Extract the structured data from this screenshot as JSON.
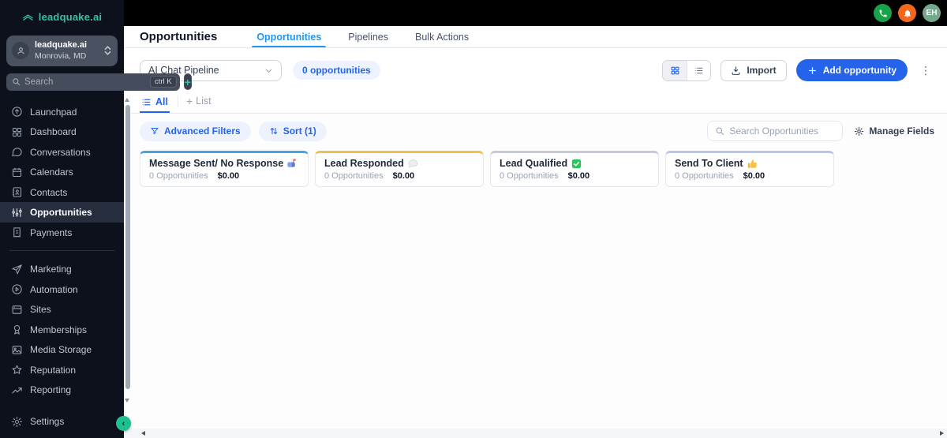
{
  "colors": {
    "sidebar_bg": "#0c111c",
    "brand_teal": "#35c3a4",
    "brand_green": "#1fc08f",
    "accent_blue": "#2563eb",
    "tab_blue": "#2196f3",
    "phone_green": "#16a34a",
    "bell_orange": "#f2691e",
    "avatar_green": "#73a98c"
  },
  "brand": {
    "logo_text": "leadquake.ai"
  },
  "topbar": {
    "avatar_initials": "EH"
  },
  "sidebar": {
    "account": {
      "name": "leadquake.ai",
      "location": "Monrovia, MD"
    },
    "search": {
      "placeholder": "Search",
      "shortcut": "ctrl K"
    },
    "nav_top": [
      {
        "label": "Launchpad"
      },
      {
        "label": "Dashboard"
      },
      {
        "label": "Conversations"
      },
      {
        "label": "Calendars"
      },
      {
        "label": "Contacts"
      },
      {
        "label": "Opportunities",
        "active": true
      },
      {
        "label": "Payments"
      }
    ],
    "nav_bottom": [
      {
        "label": "Marketing"
      },
      {
        "label": "Automation"
      },
      {
        "label": "Sites"
      },
      {
        "label": "Memberships"
      },
      {
        "label": "Media Storage"
      },
      {
        "label": "Reputation"
      },
      {
        "label": "Reporting"
      }
    ],
    "settings_label": "Settings"
  },
  "header": {
    "title": "Opportunities",
    "tabs": [
      {
        "label": "Opportunities",
        "active": true
      },
      {
        "label": "Pipelines"
      },
      {
        "label": "Bulk Actions"
      }
    ]
  },
  "toolbar": {
    "pipeline_select_value": "AI Chat Pipeline",
    "count_badge": "0 opportunities",
    "import_label": "Import",
    "add_label": "Add opportunity"
  },
  "view_tabs": {
    "all_label": "All",
    "add_list_label": "List"
  },
  "filters": {
    "advanced_label": "Advanced Filters",
    "sort_label": "Sort (1)",
    "search_placeholder": "Search Opportunities",
    "manage_fields_label": "Manage Fields"
  },
  "board": {
    "columns": [
      {
        "title": "Message Sent/ No Response",
        "icon": "mailbox-icon",
        "count": "0 Opportunities",
        "value": "$0.00",
        "accent": "#45a5e6"
      },
      {
        "title": "Lead Responded",
        "icon": "speech-bubble-icon",
        "count": "0 Opportunities",
        "value": "$0.00",
        "accent": "#f0c14b"
      },
      {
        "title": "Lead Qualified",
        "icon": "green-check-icon",
        "count": "0 Opportunities",
        "value": "$0.00",
        "accent": "#c7cad6"
      },
      {
        "title": "Send To Client",
        "icon": "thumbs-up-icon",
        "count": "0 Opportunities",
        "value": "$0.00",
        "accent": "#b8c6ea"
      }
    ]
  }
}
